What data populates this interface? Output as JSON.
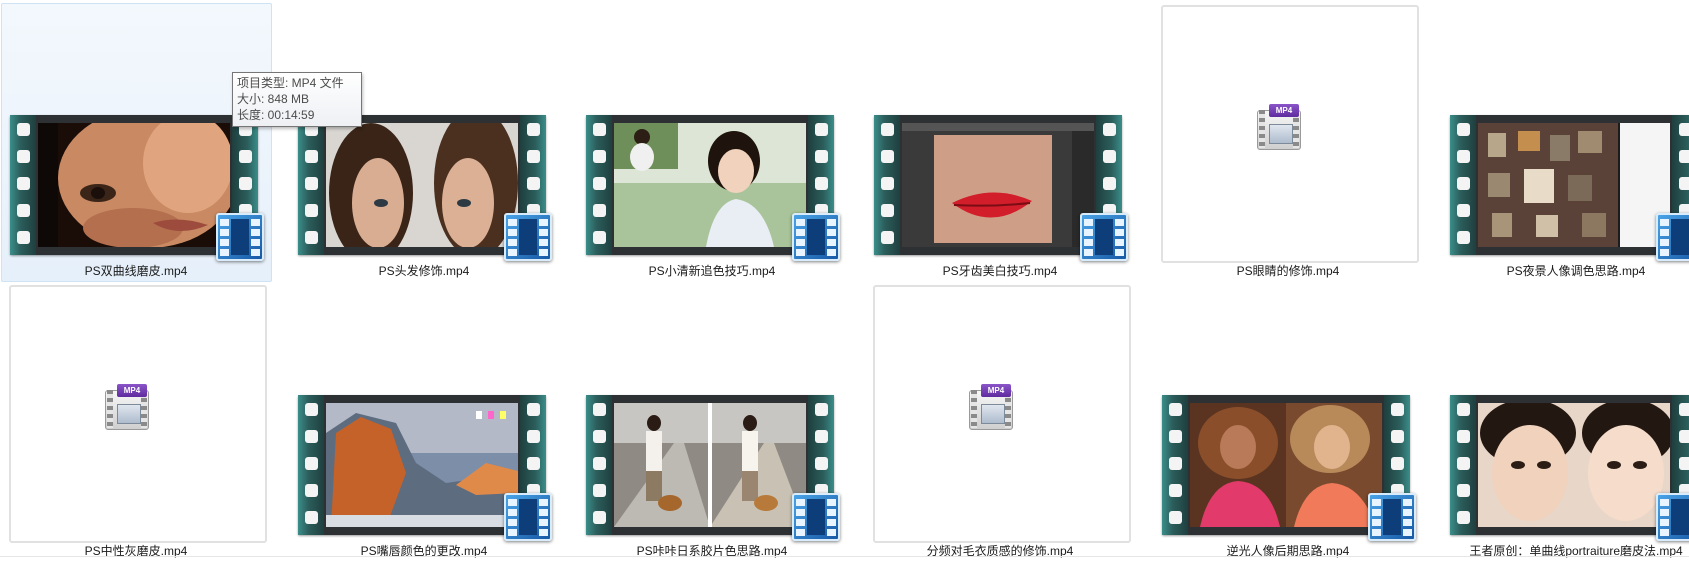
{
  "colors": {
    "selection_bg": "#e6f0fa",
    "film_rail": "#2b5e5c",
    "badge_blue": "#1759a6",
    "mp4_tag": "#5e2b9e"
  },
  "icons": {
    "film_thumbnail": "film-strip-icon",
    "video_badge": "video-file-badge-icon",
    "generic_video": "mp4-file-icon"
  },
  "mp4_tag_text": "MP4",
  "tooltip": {
    "type": "项目类型: MP4 文件",
    "size": "大小: 848 MB",
    "length": "长度: 00:14:59"
  },
  "files": [
    {
      "name": "PS双曲线磨皮.mp4",
      "thumb": "film",
      "scene": "face-closeup",
      "selected": true
    },
    {
      "name": "PS头发修饰.mp4",
      "thumb": "film",
      "scene": "two-faces"
    },
    {
      "name": "PS小清新追色技巧.mp4",
      "thumb": "film",
      "scene": "girl-smile"
    },
    {
      "name": "PS牙齿美白技巧.mp4",
      "thumb": "film",
      "scene": "lips-editor"
    },
    {
      "name": "PS眼睛的修饰.mp4",
      "thumb": "generic"
    },
    {
      "name": "PS夜景人像调色思路.mp4",
      "thumb": "film",
      "scene": "desktop-city"
    },
    {
      "name": "PS中性灰磨皮.mp4",
      "thumb": "generic"
    },
    {
      "name": "PS嘴唇颜色的更改.mp4",
      "thumb": "film",
      "scene": "mac-desktop"
    },
    {
      "name": "PS咔咔日系胶片色思路.mp4",
      "thumb": "film",
      "scene": "street-dog"
    },
    {
      "name": "分频对毛衣质感的修饰.mp4",
      "thumb": "generic"
    },
    {
      "name": "逆光人像后期思路.mp4",
      "thumb": "film",
      "scene": "backlight-women"
    },
    {
      "name": "王者原创：单曲线portraiture磨皮法.mp4",
      "thumb": "film",
      "scene": "girl-bangs"
    }
  ]
}
